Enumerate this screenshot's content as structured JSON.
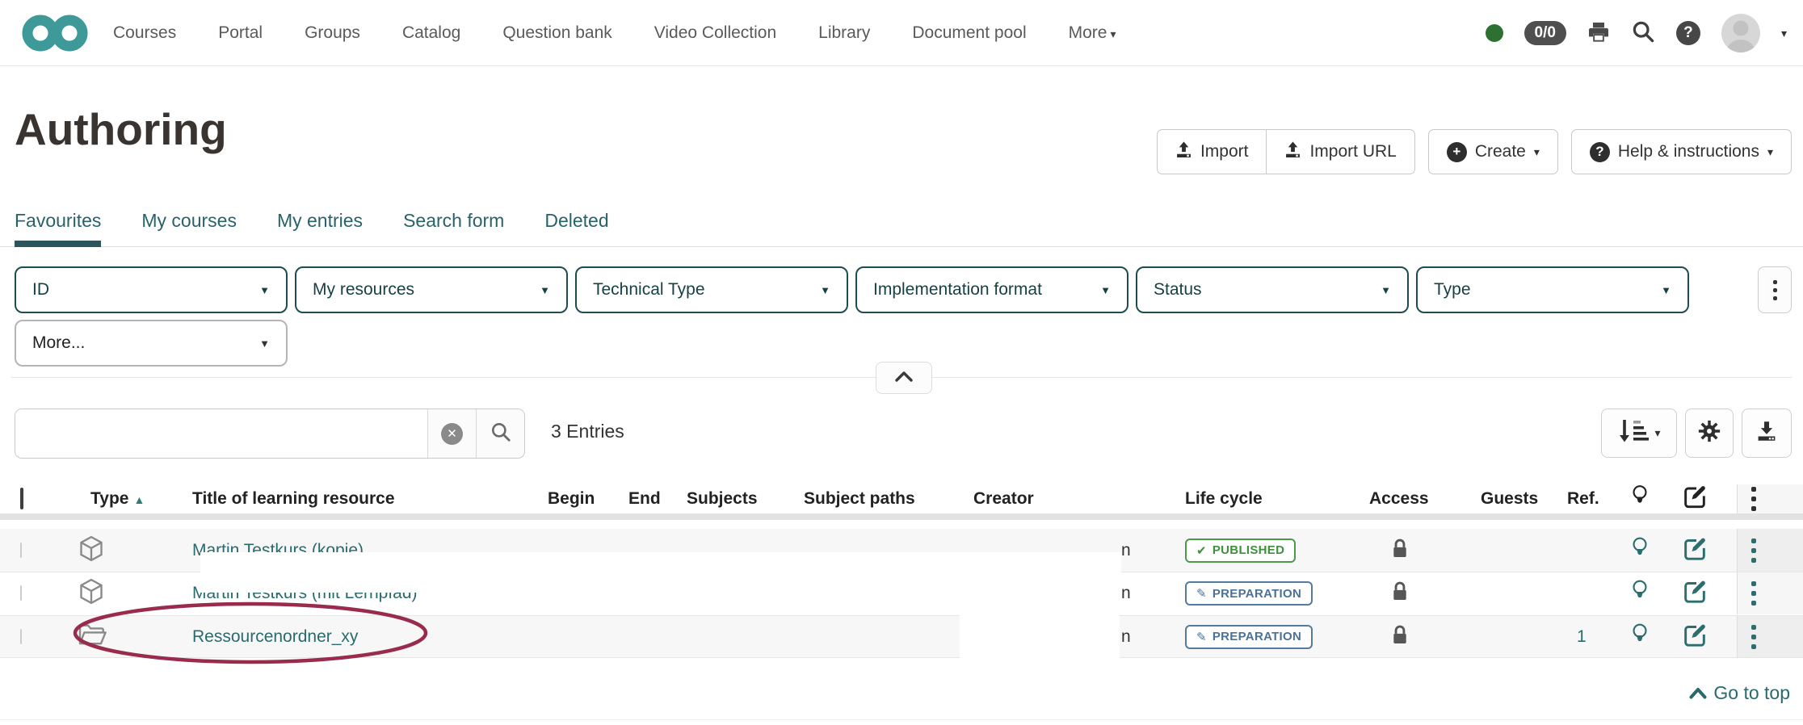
{
  "navbar": {
    "items": [
      "Courses",
      "Portal",
      "Groups",
      "Catalog",
      "Question bank",
      "Video Collection",
      "Library",
      "Document pool"
    ],
    "more_label": "More",
    "status_badge": "0/0"
  },
  "header": {
    "title": "Authoring",
    "buttons": {
      "import": "Import",
      "import_url": "Import URL",
      "create": "Create",
      "help": "Help & instructions"
    }
  },
  "tabs": [
    {
      "label": "Favourites",
      "active": true
    },
    {
      "label": "My courses",
      "active": false
    },
    {
      "label": "My entries",
      "active": false
    },
    {
      "label": "Search form",
      "active": false
    },
    {
      "label": "Deleted",
      "active": false
    }
  ],
  "filters": {
    "row1": [
      "ID",
      "My resources",
      "Technical Type",
      "Implementation format",
      "Status",
      "Type"
    ],
    "more": "More..."
  },
  "table": {
    "entries_count": "3 Entries",
    "columns": {
      "type": "Type",
      "title": "Title of learning resource",
      "begin": "Begin",
      "end": "End",
      "subjects": "Subjects",
      "subject_paths": "Subject paths",
      "creator": "Creator",
      "life_cycle": "Life cycle",
      "access": "Access",
      "guests": "Guests",
      "ref": "Ref."
    },
    "rows": [
      {
        "title": "Martin Testkurs (kopie)",
        "type": "course",
        "creator_fragment": "n",
        "life_cycle": "PUBLISHED",
        "ref": ""
      },
      {
        "title": "Martin Testkurs (mit Lernpfad)",
        "type": "course",
        "creator_fragment": "n",
        "life_cycle": "PREPARATION",
        "ref": ""
      },
      {
        "title": "Ressourcenordner_xy",
        "type": "resource-folder",
        "creator_fragment": "n",
        "life_cycle": "PREPARATION",
        "ref": "1"
      }
    ]
  },
  "footer": {
    "go_to_top": "Go to top"
  },
  "colors": {
    "accent_teal": "#2c6e6e",
    "logo_teal": "#3d9a99",
    "bookmark_red": "#9b2446",
    "published_green": "#3f8f3f",
    "preparation_blue": "#4d7196",
    "annotation_red": "#992b4d"
  }
}
